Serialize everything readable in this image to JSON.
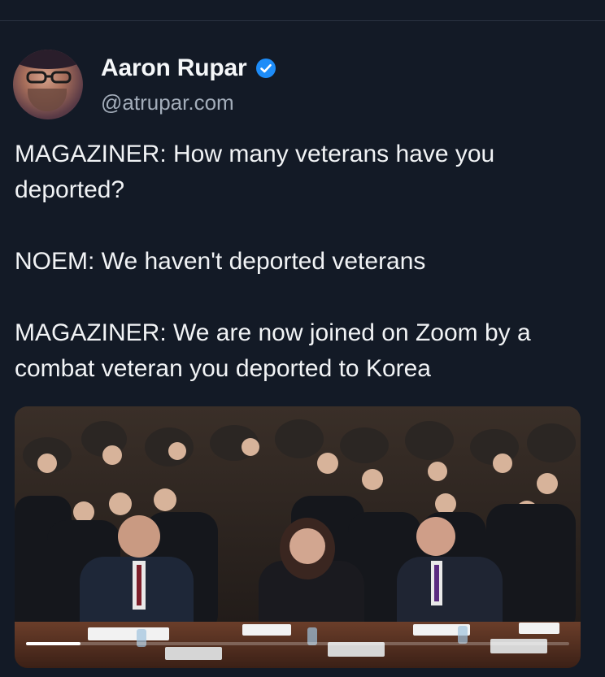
{
  "post": {
    "author": {
      "display_name": "Aaron Rupar",
      "handle": "@atrupar.com",
      "verified": true,
      "verified_color": "#1d8cf8",
      "avatar_icon": "avatar-photo"
    },
    "text_paragraphs": [
      "MAGAZINER: How many veterans have you deported?",
      "NOEM: We haven't deported veterans",
      "MAGAZINER: We are now joined on Zoom by a combat veteran you deported to Korea"
    ],
    "media": {
      "kind": "video",
      "description_icon": "video-thumbnail",
      "progress_fraction": 0.1
    }
  },
  "colors": {
    "background": "#131a26",
    "text": "#f1f3f5",
    "secondary_text": "#a3adba"
  }
}
